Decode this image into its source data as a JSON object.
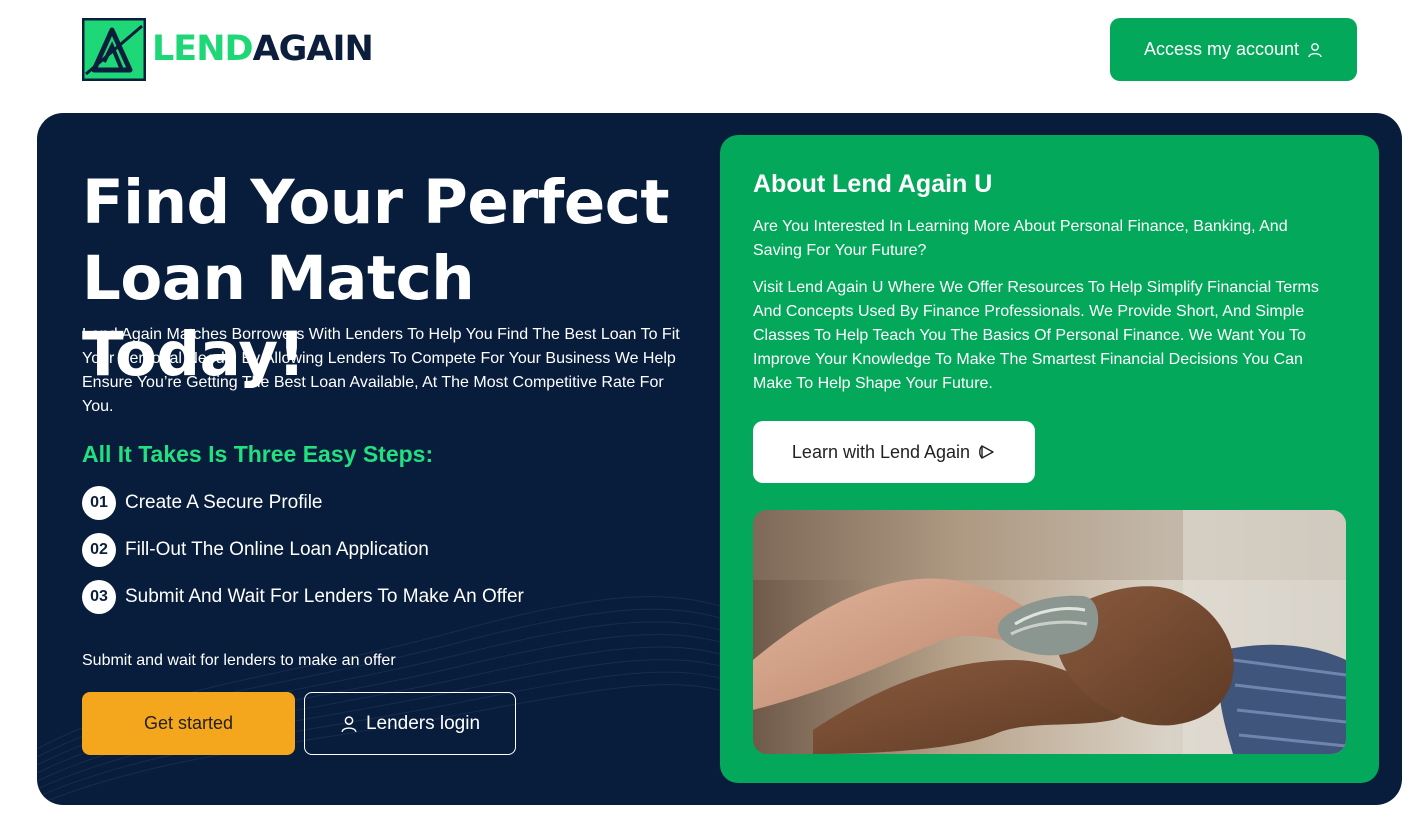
{
  "header": {
    "logo": {
      "part1": "LEND",
      "part2": "AGAIN",
      "icon": "lend-again-logo-icon"
    },
    "access_button": {
      "label": "Access my account",
      "icon": "user-icon"
    }
  },
  "hero": {
    "title_line1": "Find Your Perfect",
    "title_line2": "Loan Match Today!",
    "description": "Lend Again Matches Borrowers With Lenders To Help You Find The Best Loan To Fit Your Personal Needs. By Allowing Lenders To Compete For Your Business We Help Ensure You’re Getting The Best Loan Available, At The Most Competitive Rate For You.",
    "steps_heading": "All It Takes Is Three Easy Steps:",
    "steps": [
      {
        "num": "01",
        "label": "Create A Secure Profile"
      },
      {
        "num": "02",
        "label": "Fill-Out The Online Loan Application"
      },
      {
        "num": "03",
        "label": "Submit And Wait For Lenders To Make An Offer"
      }
    ],
    "note": "Submit and wait for lenders to make an offer",
    "get_started_label": "Get started",
    "lenders_login": {
      "label": "Lenders login",
      "icon": "user-icon"
    }
  },
  "about": {
    "title": "About Lend Again U",
    "question": "Are You Interested In Learning More About Personal Finance, Banking, And Saving For Your Future?",
    "body": "Visit Lend Again U Where We Offer Resources To Help Simplify Financial Terms And Concepts Used By Finance Professionals. We Provide Short, And Simple Classes To Help Teach You The Basics Of Personal Finance. We Want You To Improve Your Knowledge To Make The Smartest Financial Decisions You Can Make To Help Shape Your Future.",
    "learn_button": {
      "label": "Learn with Lend Again",
      "icon": "play-circle-icon"
    },
    "photo": "hands-exchanging-money-photo"
  },
  "colors": {
    "brand_green": "#04a85a",
    "accent_green": "#22e07f",
    "navy": "#081d3c",
    "orange": "#f4a61d"
  }
}
